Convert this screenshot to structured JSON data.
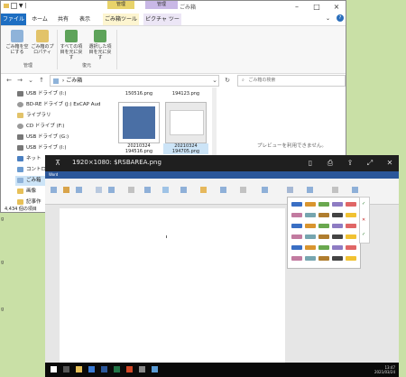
{
  "desktop": {
    "side_labels": [
      "g",
      "g",
      "g",
      "g",
      "g"
    ]
  },
  "explorer": {
    "title": "ごみ箱",
    "quick_title": "▼ |",
    "context_tabs": [
      {
        "label": "管理"
      },
      {
        "label": "管理"
      }
    ],
    "tabs": [
      {
        "label": "ファイル"
      },
      {
        "label": "ホーム"
      },
      {
        "label": "共有"
      },
      {
        "label": "表示"
      },
      {
        "label": "ごみ箱ツール"
      },
      {
        "label": "ピクチャ ツール"
      }
    ],
    "ribbon": {
      "buttons": [
        {
          "label": "ごみ箱を空にする"
        },
        {
          "label": "ごみ箱のプロパティ"
        },
        {
          "label": "すべての項目を元に戻す"
        },
        {
          "label": "選択した項目を元に戻す"
        }
      ],
      "groups": [
        {
          "label": "管理"
        },
        {
          "label": "復元"
        }
      ]
    },
    "address": {
      "path": "ごみ箱",
      "search_placeholder": "ごみ箱の検索"
    },
    "nav_items": [
      {
        "label": "USB ドライブ (I:)"
      },
      {
        "label": "BD-RE ドライブ (J:) ExCAP Aud"
      },
      {
        "label": "ライブラリ"
      },
      {
        "label": "CD ドライブ (F:)"
      },
      {
        "label": "USB ドライブ (G:)"
      },
      {
        "label": "USB ドライブ (I:)"
      },
      {
        "label": "ネット"
      },
      {
        "label": "コントロー"
      },
      {
        "label": "ごみ箱"
      },
      {
        "label": "画像"
      },
      {
        "label": "記事作"
      }
    ],
    "files": [
      {
        "name": "150516.png"
      },
      {
        "name": "194123.png"
      },
      {
        "name": "20210324 194516.png"
      },
      {
        "name": "20210324 194705.png"
      }
    ],
    "preview_text": "プレビューを利用できません。",
    "status": "4,434 個の項目"
  },
  "viewer": {
    "title": "1920×1080: $RSBAREA.png",
    "doc_title": "Word",
    "tray_time": "13:47",
    "tray_date": "2021/03/24",
    "wordart_colors": [
      "#3a6fc4",
      "#d9952f",
      "#6aa84f",
      "#8e7cc3",
      "#e06666",
      "#c27ba0",
      "#76a5af",
      "#b07d2e",
      "#444444",
      "#f1c232"
    ]
  }
}
